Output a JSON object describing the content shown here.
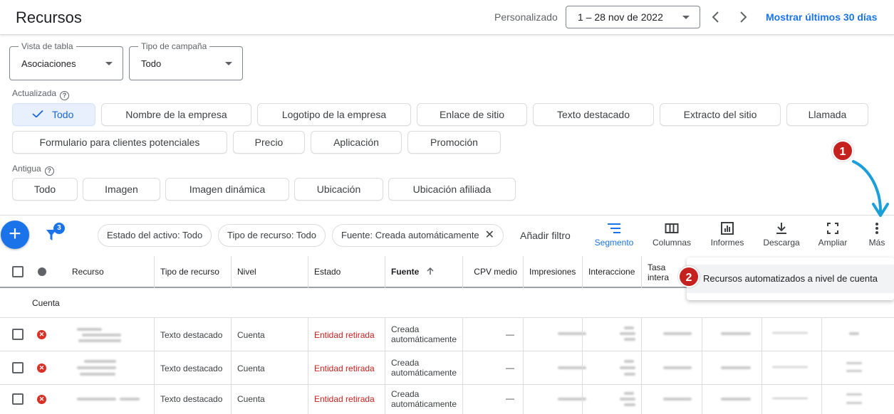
{
  "header": {
    "title": "Recursos",
    "date_label": "Personalizado",
    "date_range": "1 – 28 nov de 2022",
    "show_last": "Mostrar últimos 30 días"
  },
  "selects": {
    "table_view": {
      "label": "Vista de tabla",
      "value": "Asociaciones"
    },
    "campaign_type": {
      "label": "Tipo de campaña",
      "value": "Todo"
    }
  },
  "updated": {
    "label": "Actualizada",
    "chips": [
      "Todo",
      "Nombre de la empresa",
      "Logotipo de la empresa",
      "Enlace de sitio",
      "Texto destacado",
      "Extracto del sitio",
      "Llamada",
      "Formulario para clientes potenciales",
      "Precio",
      "Aplicación",
      "Promoción"
    ]
  },
  "legacy": {
    "label": "Antigua",
    "chips": [
      "Todo",
      "Imagen",
      "Imagen dinámica",
      "Ubicación",
      "Ubicación afiliada"
    ]
  },
  "filters": {
    "badge_count": "3",
    "chips": [
      "Estado del activo: Todo",
      "Tipo de recurso: Todo",
      "Fuente: Creada automáticamente"
    ],
    "add_filter": "Añadir filtro"
  },
  "tools": [
    "Segmento",
    "Columnas",
    "Informes",
    "Descarga",
    "Ampliar",
    "Más"
  ],
  "table": {
    "headers": [
      "Recurso",
      "Tipo de recurso",
      "Nivel",
      "Estado",
      "Fuente",
      "CPV medio",
      "Impresiones",
      "Interaccione",
      "Tasa intera"
    ],
    "group_label": "Cuenta",
    "rows": [
      {
        "type": "Texto destacado",
        "level": "Cuenta",
        "status": "Entidad retirada",
        "source": "Creada automáticamente",
        "cpv": "—"
      },
      {
        "type": "Texto destacado",
        "level": "Cuenta",
        "status": "Entidad retirada",
        "source": "Creada automáticamente",
        "cpv": "—"
      },
      {
        "type": "Texto destacado",
        "level": "Cuenta",
        "status": "Entidad retirada",
        "source": "Creada automáticamente",
        "cpv": "—"
      }
    ]
  },
  "menu": {
    "item": "Recursos automatizados a nivel de cuenta"
  },
  "annotations": {
    "step1": "1",
    "step2": "2"
  },
  "colors": {
    "accent": "#1a73e8",
    "danger": "#c5221f",
    "annotation_arrow": "#1a9fd8"
  }
}
